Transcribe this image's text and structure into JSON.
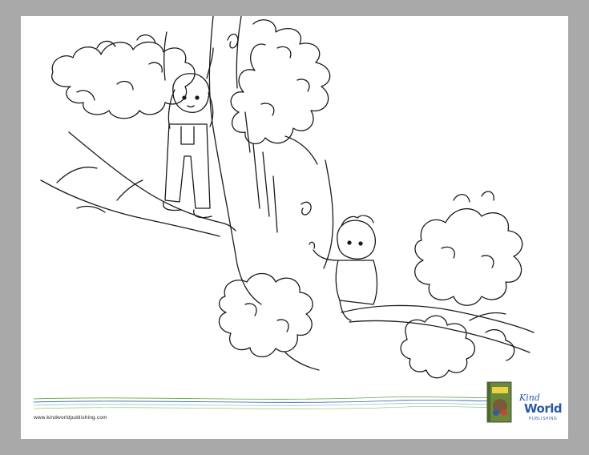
{
  "footer": {
    "url": "www.kindworldpublishing.com"
  },
  "logo": {
    "kind": "Kind",
    "world": "World",
    "publishing": "PUBLISHING"
  },
  "colors": {
    "background": "#a9a9a9",
    "page": "#ffffff",
    "line_art": "#1a1a1a",
    "brand_blue": "#2a5aa6",
    "brand_green": "#5aa83a"
  }
}
